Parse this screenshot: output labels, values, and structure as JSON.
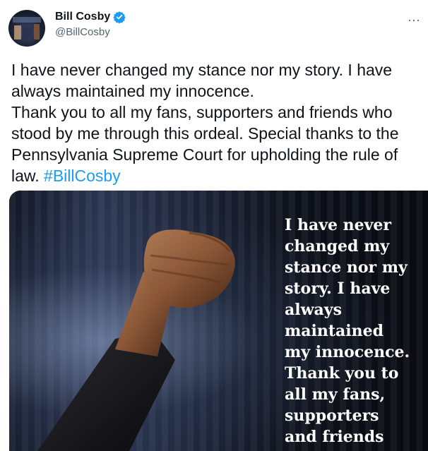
{
  "author": {
    "display_name": "Bill Cosby",
    "handle": "@BillCosby",
    "verified": true,
    "avatar_icon": "profile-photo"
  },
  "menu": {
    "more_label": "···"
  },
  "tweet": {
    "line1": "I have never changed my stance nor my story. I have always maintained my innocence.",
    "line2": "Thank you to all my fans, supporters and friends who stood by me through this ordeal. Special thanks to the Pennsylvania Supreme Court for upholding the rule of law.",
    "hashtag": "#BillCosby"
  },
  "media": {
    "overlay_text": "I have never\nchanged my\nstance nor my\nstory. I have\nalways\nmaintained\nmy innocence.\nThank you to\nall my fans,\nsupporters\nand friends"
  },
  "colors": {
    "accent": "#1d9bf0",
    "text": "#0f1419",
    "secondary": "#536471"
  }
}
